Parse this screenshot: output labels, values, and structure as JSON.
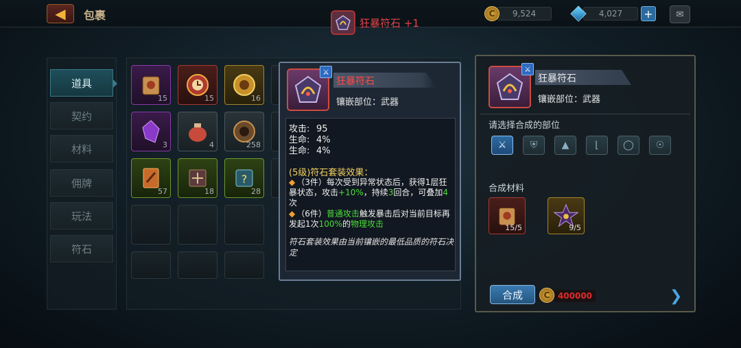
{
  "topbar": {
    "page_title": "包裹",
    "center_title": "狂暴符石 +1",
    "gold": "9,524",
    "gems": "4,027"
  },
  "tabs": [
    {
      "label": "道具",
      "active": true
    },
    {
      "label": "契约",
      "active": false
    },
    {
      "label": "材料",
      "active": false
    },
    {
      "label": "佣牌",
      "active": false
    },
    {
      "label": "玩法",
      "active": false
    },
    {
      "label": "符石",
      "active": false
    }
  ],
  "grid": {
    "items": [
      {
        "count": "15",
        "quality": "purple",
        "icon": "scroll-icon"
      },
      {
        "count": "15",
        "quality": "red",
        "icon": "clock-shield-icon"
      },
      {
        "count": "16",
        "quality": "gold",
        "icon": "gold-shield-icon"
      },
      {
        "count": "3",
        "quality": "purple",
        "icon": "purple-crystal-icon"
      },
      {
        "count": "4",
        "quality": "gray",
        "icon": "pouch-icon"
      },
      {
        "count": "258",
        "quality": "gray",
        "icon": "bronze-shield-icon"
      },
      {
        "count": "57",
        "quality": "green",
        "icon": "card-icon"
      },
      {
        "count": "18",
        "quality": "green",
        "icon": "book-icon"
      },
      {
        "count": "28",
        "quality": "green",
        "icon": "mystery-box-icon"
      }
    ]
  },
  "tooltip": {
    "name": "狂暴符石",
    "slot_text": "镶嵌部位：武器",
    "stats": [
      {
        "label": "攻击:",
        "value": "95"
      },
      {
        "label": "生命:",
        "value": "4%"
      },
      {
        "label": "生命:",
        "value": "4%"
      }
    ],
    "set_title": "(5级)符石套装效果：",
    "set3_prefix": "（3件）每次受到异常状态后，获得1层狂暴状态，攻击",
    "set3_value": "+10%",
    "set3_mid": "，持续",
    "set3_turns": "3",
    "set3_mid2": "回合，可叠加",
    "set3_stack": "4",
    "set3_suffix": "次",
    "set6_prefix": "（6件）",
    "set6_attack": "普通攻击",
    "set6_mid": "触发暴击后对当前目标再发起1次",
    "set6_pct": "100%",
    "set6_mid2": "的",
    "set6_type": "物理攻击",
    "note": "符石套装效果由当前镶嵌的最低品质的符石决定"
  },
  "right_panel": {
    "name": "狂暴符石",
    "slot_text": "镶嵌部位：武器",
    "choose_label": "请选择合成的部位",
    "parts": [
      {
        "icon": "sword-icon",
        "active": true
      },
      {
        "icon": "armor-icon",
        "active": false
      },
      {
        "icon": "helmet-icon",
        "active": false
      },
      {
        "icon": "boots-icon",
        "active": false
      },
      {
        "icon": "ring-icon",
        "active": false
      },
      {
        "icon": "amulet-icon",
        "active": false
      }
    ],
    "materials_label": "合成材料",
    "materials": [
      {
        "count": "15/5",
        "icon": "scroll-icon",
        "quality": "red"
      },
      {
        "count": "9/5",
        "icon": "dark-star-icon",
        "quality": "gold"
      }
    ],
    "craft_label": "合成",
    "cost": "400000"
  }
}
